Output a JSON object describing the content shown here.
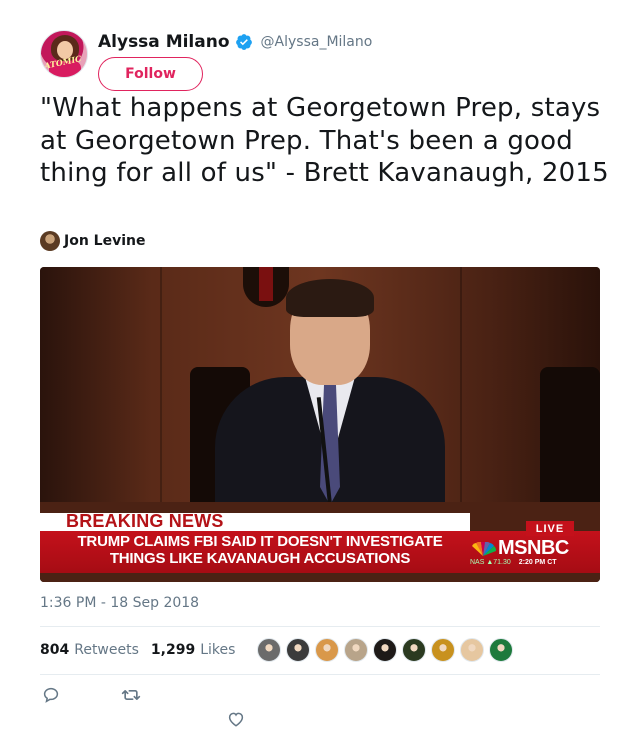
{
  "header": {
    "name": "Alyssa Milano",
    "handle": "@Alyssa_Milano",
    "follow_label": "Follow",
    "avatar_text": "ATOMIC"
  },
  "tweet": {
    "text": "\"What happens at Georgetown Prep, stays at Georgetown Prep. That's been a good thing for all of us\" - Brett Kavanaugh, 2015"
  },
  "media": {
    "author": "Jon Levine",
    "breaking_label": "BREAKING NEWS",
    "headline": "TRUMP CLAIMS FBI SAID IT DOESN'T INVESTIGATE THINGS LIKE KAVANAUGH ACCUSATIONS",
    "live_label": "LIVE",
    "network": "MSNBC",
    "ticker_nas": "NAS ▲71.30",
    "ticker_time": "2:20 PM CT"
  },
  "meta": {
    "timestamp": "1:36 PM - 18 Sep 2018"
  },
  "stats": {
    "retweets_count": "804",
    "retweets_label": "Retweets",
    "likes_count": "1,299",
    "likes_label": "Likes"
  },
  "likers": [
    {
      "name": "liker-avatar-1",
      "color": "#6b6b6b"
    },
    {
      "name": "liker-avatar-2",
      "color": "#3b3b3b"
    },
    {
      "name": "liker-avatar-3",
      "color": "#d9984a"
    },
    {
      "name": "liker-avatar-4",
      "color": "#b8a48a"
    },
    {
      "name": "liker-avatar-5",
      "color": "#1e1a18"
    },
    {
      "name": "liker-avatar-6",
      "color": "#2b3a20"
    },
    {
      "name": "liker-avatar-7",
      "color": "#c8911e"
    },
    {
      "name": "liker-avatar-8",
      "color": "#e6c7a0"
    },
    {
      "name": "liker-avatar-9",
      "color": "#1e7a3c"
    }
  ],
  "colors": {
    "accent": "#e0245e",
    "verified": "#1da1f2",
    "muted": "#657786",
    "breaking_red": "#c4111b"
  },
  "icons": {
    "verified": "verified-badge-icon",
    "reply": "reply-icon",
    "retweet": "retweet-icon",
    "like": "heart-icon"
  }
}
